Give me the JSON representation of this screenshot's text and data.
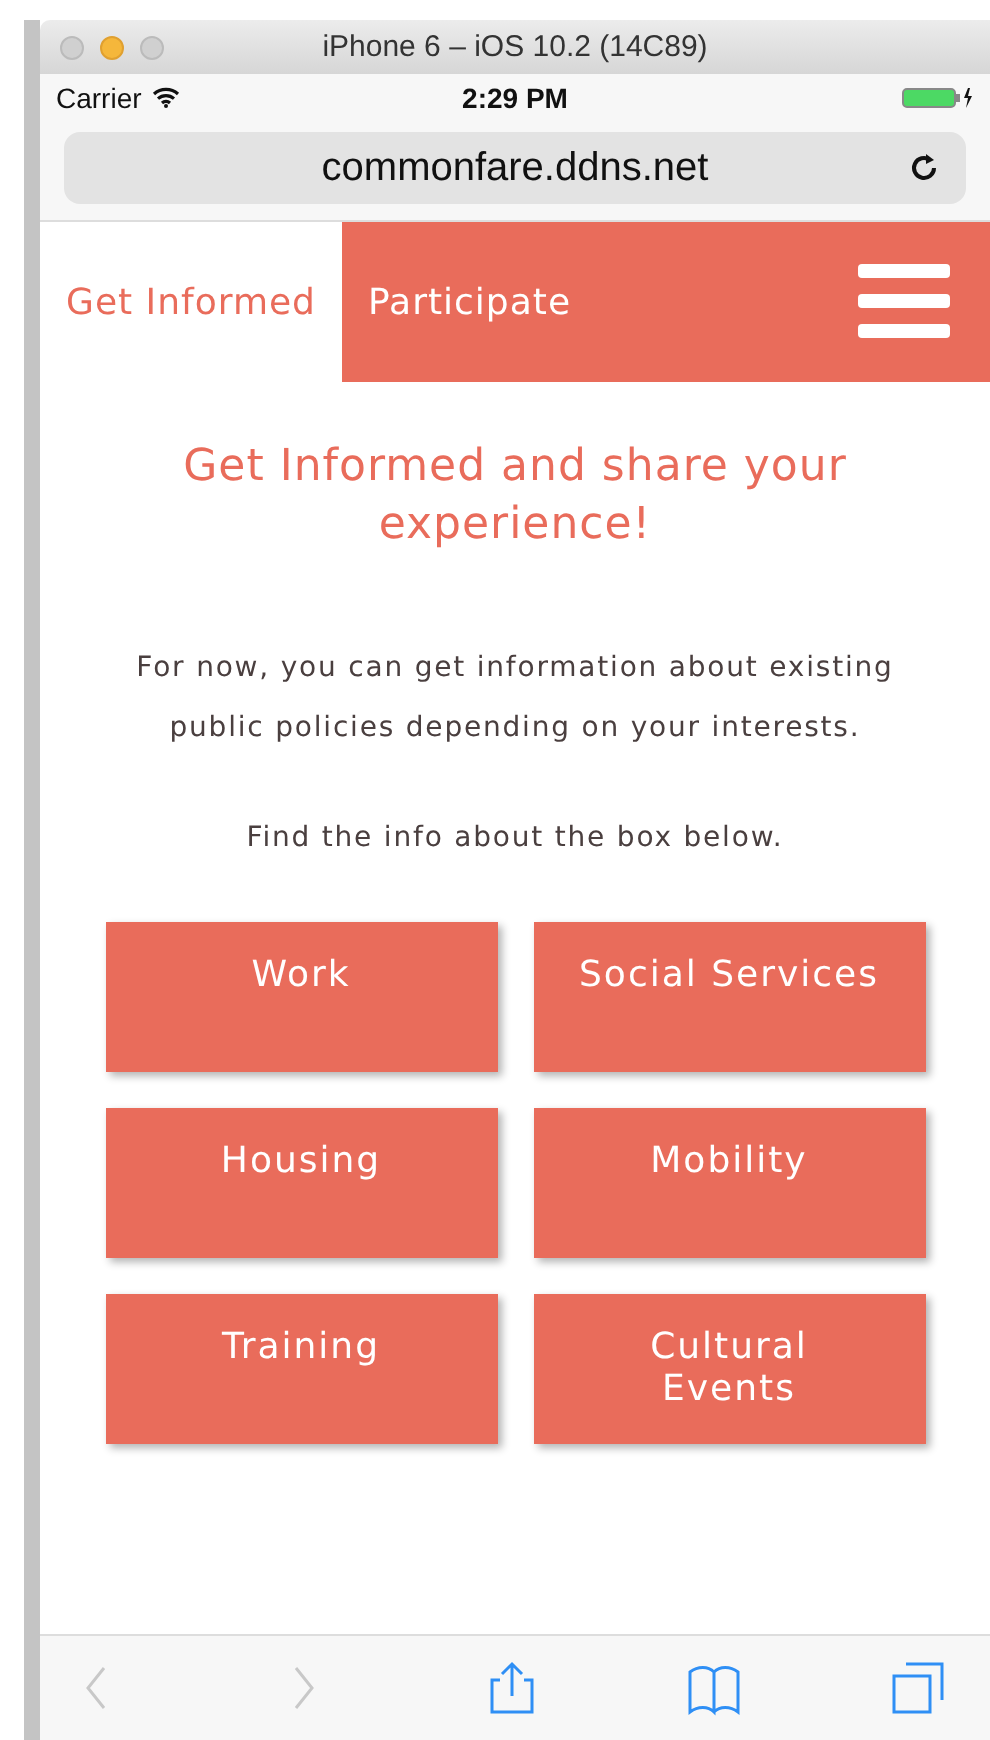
{
  "window": {
    "title": "iPhone 6 – iOS 10.2 (14C89)"
  },
  "status_bar": {
    "carrier": "Carrier",
    "time": "2:29 PM"
  },
  "address_bar": {
    "url": "commonfare.ddns.net"
  },
  "nav": {
    "tabs": [
      {
        "label": "Get Informed",
        "selected": true
      },
      {
        "label": "Participate",
        "selected": false
      }
    ]
  },
  "heading": "Get Informed and share your experience!",
  "intro": "For now, you can get information about existing public policies depending on your interests.",
  "hint": "Find the info about the box below.",
  "tiles": [
    {
      "label": "Work"
    },
    {
      "label": "Social Services"
    },
    {
      "label": "Housing"
    },
    {
      "label": "Mobility"
    },
    {
      "label": "Training"
    },
    {
      "label": "Cultural Events"
    }
  ],
  "toolbar": [
    {
      "kind": "back",
      "disabled": true
    },
    {
      "kind": "forward",
      "disabled": true
    },
    {
      "kind": "share",
      "disabled": false
    },
    {
      "kind": "bookmarks",
      "disabled": false
    },
    {
      "kind": "tabs",
      "disabled": false
    }
  ]
}
